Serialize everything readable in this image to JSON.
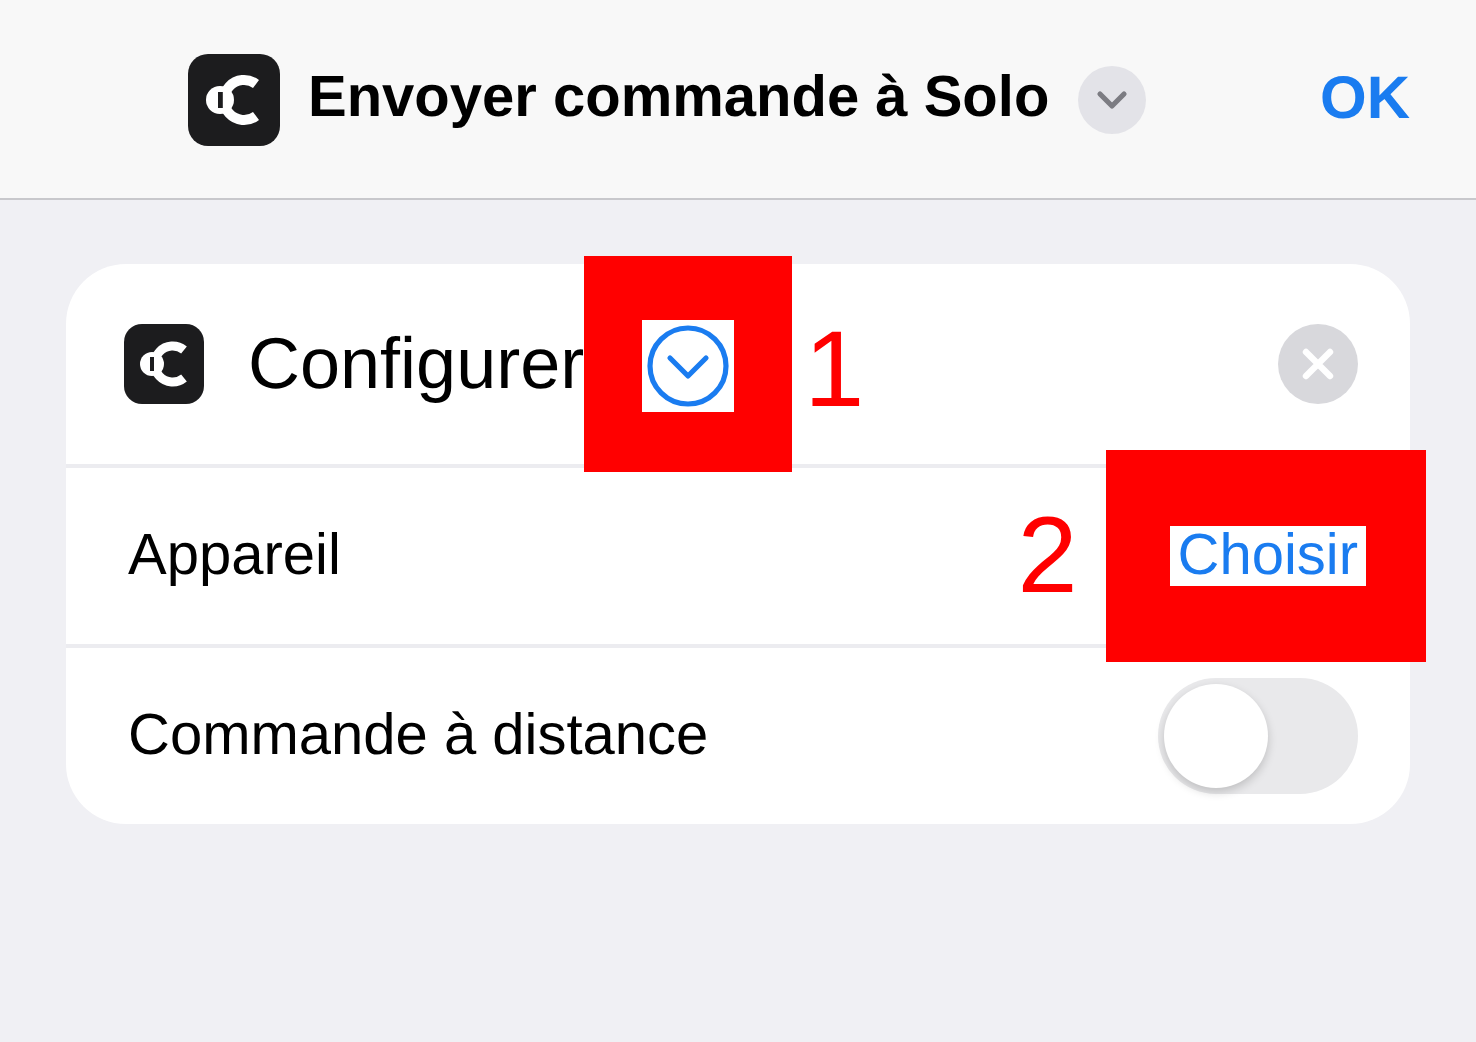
{
  "header": {
    "title": "Envoyer commande à Solo",
    "done_button": "OK"
  },
  "action": {
    "title": "Configurer",
    "params": [
      {
        "kind": "picker",
        "label": "Appareil",
        "value": "Choisir"
      },
      {
        "kind": "toggle",
        "label": "Commande à distance",
        "on": false
      }
    ]
  },
  "annotations": [
    {
      "number": "1"
    },
    {
      "number": "2"
    }
  ]
}
